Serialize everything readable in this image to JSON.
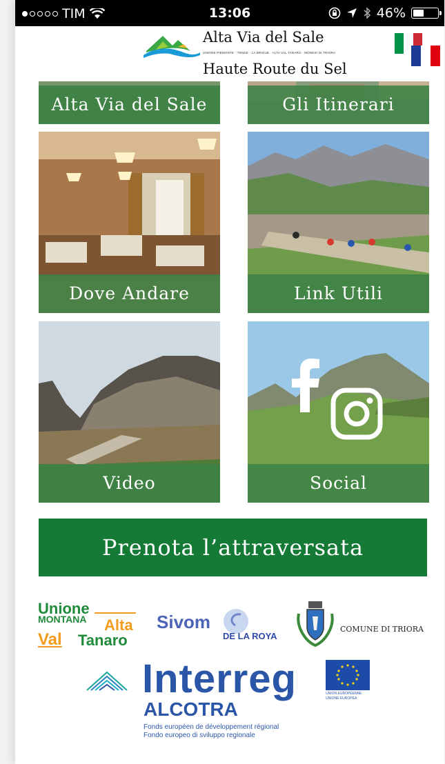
{
  "status_bar": {
    "carrier": "TIM",
    "time": "13:06",
    "battery": "46%",
    "signal_bars_filled": 1,
    "signal_bars_total": 5,
    "battery_level": 0.46
  },
  "header": {
    "logo_title": "Alta Via del Sale",
    "logo_tagline": "UNIONE PIEMONTE · TENDE · LA BRIGUE · ALTA VAL TANARO · MONESI DI TRIORA",
    "logo_subtitle": "Haute Route du Sel",
    "languages": [
      "Italiano",
      "Français"
    ]
  },
  "tiles": [
    {
      "id": "alta-via",
      "label": "Alta Via del Sale"
    },
    {
      "id": "itinerari",
      "label": "Gli Itinerari"
    },
    {
      "id": "dove-andare",
      "label": "Dove Andare"
    },
    {
      "id": "link-utili",
      "label": "Link Utili"
    },
    {
      "id": "video",
      "label": "Video"
    },
    {
      "id": "social",
      "label": "Social"
    }
  ],
  "cta": {
    "label": "Prenota l’attraversata"
  },
  "partners": {
    "unione": {
      "line1": "Unione",
      "line2": "MONTANA",
      "line2b": "Alta",
      "line3": "Val",
      "line3b": "Tanaro"
    },
    "sivom": {
      "name": "Sivom",
      "sub": "DE LA ROYA"
    },
    "triora": {
      "name": "COMUNE DI TRIORA"
    },
    "interreg": {
      "word": "Interreg",
      "program": "ALCOTRA",
      "fund_fr": "Fonds européen de développement régional",
      "fund_it": "Fondo europeo di sviluppo regionale",
      "eu_fr": "UNION EUROPÉENNE",
      "eu_it": "UNIONE EUROPEA"
    }
  },
  "colors": {
    "band_green": "#3e8246",
    "cta_green": "#167a37",
    "interreg_blue": "#2b56a8",
    "eu_blue": "#1d4ba8"
  }
}
